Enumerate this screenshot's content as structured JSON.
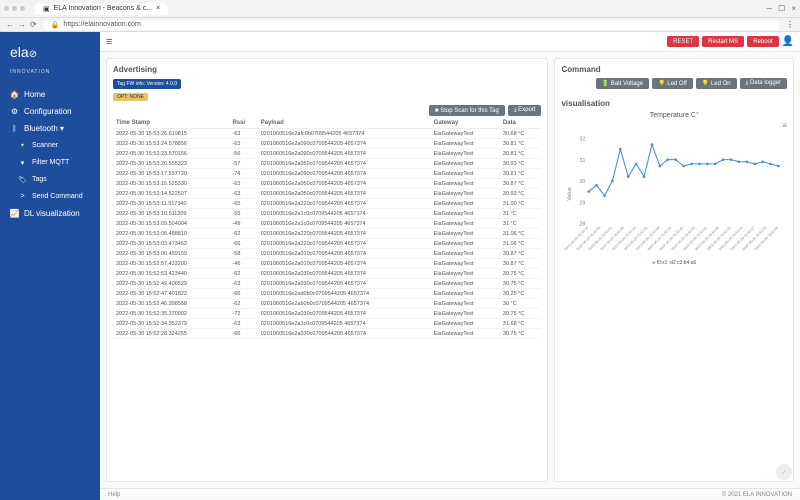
{
  "browser": {
    "tab_title": "ELA Innovation - Beacons & c...",
    "url": "https://elainnovation.com",
    "lock": "🔒"
  },
  "logo": {
    "line1": "ela",
    "line2": "INNOVATION"
  },
  "sidebar": {
    "items": [
      {
        "icon": "🏠",
        "label": "Home"
      },
      {
        "icon": "⚙",
        "label": "Configuration"
      },
      {
        "icon": "ᛒ",
        "label": "Bluetooth ▾"
      },
      {
        "icon": "⭑",
        "label": "Scanner",
        "sub": true
      },
      {
        "icon": "▾",
        "label": "Filter MQTT",
        "sub": true
      },
      {
        "icon": "🏷",
        "label": "Tags",
        "sub": true
      },
      {
        "icon": ">",
        "label": "Send Command",
        "sub": true
      },
      {
        "icon": "📈",
        "label": "DL visualization"
      }
    ]
  },
  "topbar": {
    "menu": "≡",
    "reset": "RESET",
    "restart": "Restart MS",
    "reboot": "Reboot",
    "user_icon": "👤"
  },
  "advertising": {
    "title": "Advertising",
    "fw_badge": "Tag FW info: Version: 4.0.0",
    "opt_badge": "OPT: NONE",
    "stop": "■ Stop Scan for this Tag",
    "export": "⤓ Export",
    "headers": {
      "ts": "Time Stamp",
      "rssi": "Rssi",
      "payload": "Payload",
      "gateway": "Gateway",
      "data": "Data"
    },
    "rows": [
      {
        "ts": "2022-05-30 15:53:26.619815",
        "rssi": "-63",
        "payload": "0201060516e2afc0b0709544205 4657374",
        "gw": "ElaGatewayTest",
        "data": "30.68 °C"
      },
      {
        "ts": "2022-05-30 15:53:24.578856",
        "rssi": "-63",
        "payload": "0201060516e2a090c0709544205 4657374",
        "gw": "ElaGatewayTest",
        "data": "30.81 °C"
      },
      {
        "ts": "2022-05-30 15:53:23.570156",
        "rssi": "-56",
        "payload": "0201060516e2a090c0709544205 4657374",
        "gw": "ElaGatewayTest",
        "data": "30.81 °C"
      },
      {
        "ts": "2022-05-30 15:53:20.555323",
        "rssi": "-57",
        "payload": "0201060516e2a050c0709544205 4657374",
        "gw": "ElaGatewayTest",
        "data": "30.93 °C"
      },
      {
        "ts": "2022-05-30 15:53:17.537720",
        "rssi": "-74",
        "payload": "0201060516e2a090c0709544205 4657374",
        "gw": "ElaGatewayTest",
        "data": "30.81 °C"
      },
      {
        "ts": "2022-05-30 15:53:15.525330",
        "rssi": "-63",
        "payload": "0201060516e2a050c0709544205 4657374",
        "gw": "ElaGatewayTest",
        "data": "30.87 °C"
      },
      {
        "ts": "2022-05-30 15:53:14.522507",
        "rssi": "-63",
        "payload": "0201060516e2a050c0709544205 4657374",
        "gw": "ElaGatewayTest",
        "data": "30.93 °C"
      },
      {
        "ts": "2022-05-30 15:53:11.517340",
        "rssi": "-65",
        "payload": "0201060516e2a220c0709544205 4657374",
        "gw": "ElaGatewayTest",
        "data": "31.00 °C"
      },
      {
        "ts": "2022-05-30 15:53:10.511209",
        "rssi": "-55",
        "payload": "0201060516e2a1c0c0709544205 4657374",
        "gw": "ElaGatewayTest",
        "data": "31 °C"
      },
      {
        "ts": "2022-05-30 15:53:09.504004",
        "rssi": "-49",
        "payload": "0201060516e2a1c0c0709544205 4657374",
        "gw": "ElaGatewayTest",
        "data": "31 °C"
      },
      {
        "ts": "2022-05-30 15:53:06.488810",
        "rssi": "-62",
        "payload": "0201060516e2a220c0709544205 4657374",
        "gw": "ElaGatewayTest",
        "data": "31.06 °C"
      },
      {
        "ts": "2022-05-30 15:53:03.473462",
        "rssi": "-66",
        "payload": "0201060516e2a220c0709544205 4657374",
        "gw": "ElaGatewayTest",
        "data": "31.06 °C"
      },
      {
        "ts": "2022-05-30 15:53:00.459159",
        "rssi": "-58",
        "payload": "0201060516e2a010c0709544205 4657374",
        "gw": "ElaGatewayTest",
        "data": "30.87 °C"
      },
      {
        "ts": "2022-05-30 15:52:57.433200",
        "rssi": "-46",
        "payload": "0201060516e2a010c0709544205 4657374",
        "gw": "ElaGatewayTest",
        "data": "30.87 °C"
      },
      {
        "ts": "2022-05-30 15:52:53.423440",
        "rssi": "-62",
        "payload": "0201060516e2a030c0709544205 4657374",
        "gw": "ElaGatewayTest",
        "data": "30.75 °C"
      },
      {
        "ts": "2022-05-30 15:52:49.406529",
        "rssi": "-63",
        "payload": "0201060516e2a030c0709544205 4657374",
        "gw": "ElaGatewayTest",
        "data": "30.75 °C"
      },
      {
        "ts": "2022-05-30 15:52:47.401822",
        "rssi": "-66",
        "payload": "0201060516e2ad0b0c0709544205 4657374",
        "gw": "ElaGatewayTest",
        "data": "30.25 °C"
      },
      {
        "ts": "2022-05-30 15:52:46.398558",
        "rssi": "-62",
        "payload": "0201060516e2ab0b0c0709544205 4657374",
        "gw": "ElaGatewayTest",
        "data": "30 °C"
      },
      {
        "ts": "2022-05-30 15:52:35.370002",
        "rssi": "-72",
        "payload": "0201060516e2a030c0709544205 4657374",
        "gw": "ElaGatewayTest",
        "data": "30.75 °C"
      },
      {
        "ts": "2022-05-30 15:52:34.352379",
        "rssi": "-63",
        "payload": "0201060516e2a1c0c0709544205 4657374",
        "gw": "ElaGatewayTest",
        "data": "31.68 °C"
      },
      {
        "ts": "2022-05-30 15:52:28.324255",
        "rssi": "-66",
        "payload": "0201060516e2a030c0709544205 4657374",
        "gw": "ElaGatewayTest",
        "data": "30.75 °C"
      }
    ]
  },
  "command": {
    "title": "Command",
    "batt": "🔋 Batt Voltage",
    "led_off": "💡 Led Off",
    "led_on": "💡 Led On",
    "data_logger": "⤓ Data logger"
  },
  "chart_title": "visualisation",
  "chart_data": {
    "type": "line",
    "title": "Temperature C°",
    "xlabel": "",
    "ylabel": "Value",
    "ylim": [
      28,
      32
    ],
    "yticks": [
      28,
      29,
      30,
      31,
      32
    ],
    "series": [
      {
        "name": "f0:x1 :d2:c3:b4:a5",
        "values": [
          29.5,
          29.8,
          29.3,
          30.0,
          31.5,
          30.2,
          30.8,
          30.2,
          31.7,
          30.7,
          31.0,
          31.0,
          30.7,
          30.8,
          30.8,
          30.8,
          30.8,
          31.0,
          31.0,
          30.9,
          30.9,
          30.8,
          30.9,
          30.8,
          30.7
        ]
      }
    ],
    "x_categories": [
      "2022-05-30 15:49:15",
      "2022-05-30 15:49:54",
      "2022-05-30 15:50:21",
      "2022-05-30 15:50:48",
      "2022-05-30 15:51:14",
      "2022-05-30 15:51:41",
      "2022-05-30 15:52:08",
      "2022-05-30 15:52:35",
      "2022-05-30 15:52:47",
      "2022-05-30 15:52:53",
      "2022-05-30 15:53:00",
      "2022-05-30 15:53:06",
      "2022-05-30 15:53:10",
      "2022-05-30 15:53:14",
      "2022-05-30 15:53:17",
      "2022-05-30 15:53:23",
      "2022-05-30 15:53:26"
    ]
  },
  "footer": {
    "help": "Help",
    "copyright": "© 2021 ELA INNOVATION"
  }
}
